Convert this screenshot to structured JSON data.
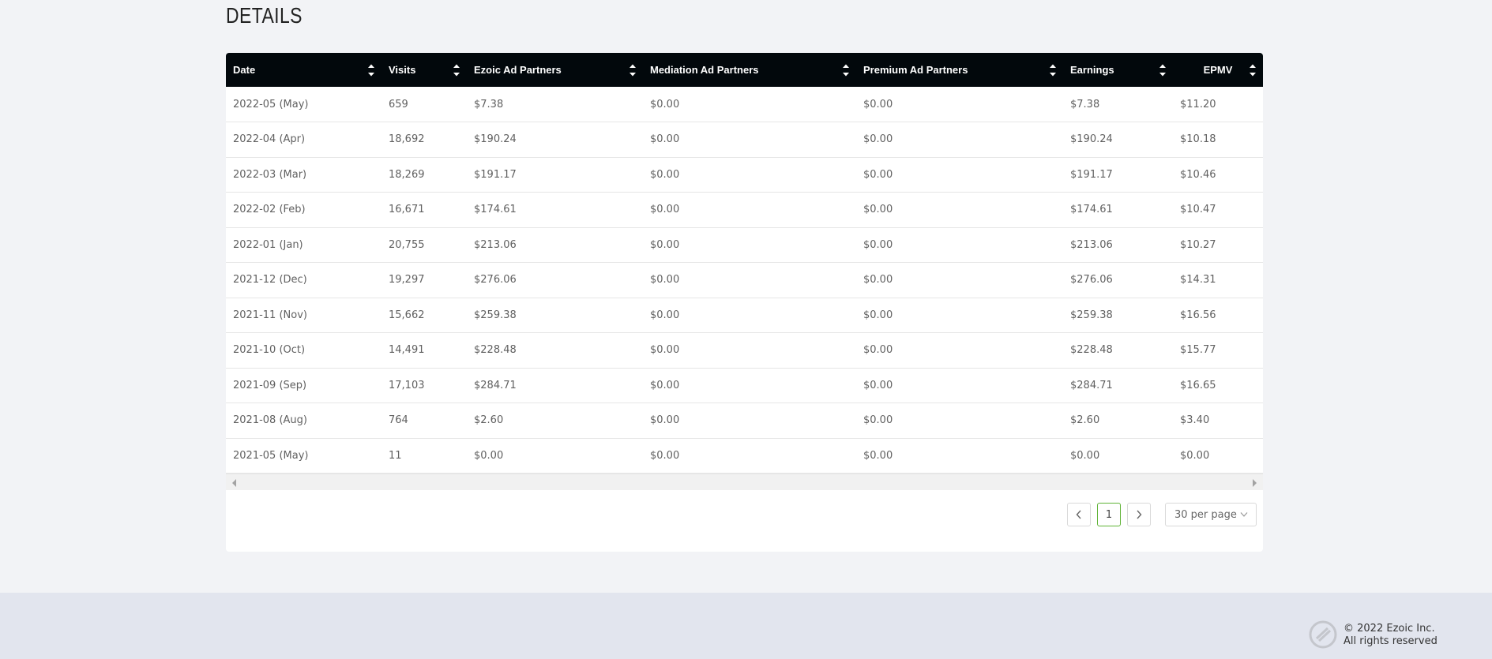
{
  "section": {
    "title": "DETAILS"
  },
  "table": {
    "columns": [
      "Date",
      "Visits",
      "Ezoic Ad Partners",
      "Mediation Ad Partners",
      "Premium Ad Partners",
      "Earnings",
      "EPMV"
    ],
    "rows": [
      [
        "2022-05 (May)",
        "659",
        "$7.38",
        "$0.00",
        "$0.00",
        "$7.38",
        "$11.20"
      ],
      [
        "2022-04 (Apr)",
        "18,692",
        "$190.24",
        "$0.00",
        "$0.00",
        "$190.24",
        "$10.18"
      ],
      [
        "2022-03 (Mar)",
        "18,269",
        "$191.17",
        "$0.00",
        "$0.00",
        "$191.17",
        "$10.46"
      ],
      [
        "2022-02 (Feb)",
        "16,671",
        "$174.61",
        "$0.00",
        "$0.00",
        "$174.61",
        "$10.47"
      ],
      [
        "2022-01 (Jan)",
        "20,755",
        "$213.06",
        "$0.00",
        "$0.00",
        "$213.06",
        "$10.27"
      ],
      [
        "2021-12 (Dec)",
        "19,297",
        "$276.06",
        "$0.00",
        "$0.00",
        "$276.06",
        "$14.31"
      ],
      [
        "2021-11 (Nov)",
        "15,662",
        "$259.38",
        "$0.00",
        "$0.00",
        "$259.38",
        "$16.56"
      ],
      [
        "2021-10 (Oct)",
        "14,491",
        "$228.48",
        "$0.00",
        "$0.00",
        "$228.48",
        "$15.77"
      ],
      [
        "2021-09 (Sep)",
        "17,103",
        "$284.71",
        "$0.00",
        "$0.00",
        "$284.71",
        "$16.65"
      ],
      [
        "2021-08 (Aug)",
        "764",
        "$2.60",
        "$0.00",
        "$0.00",
        "$2.60",
        "$3.40"
      ],
      [
        "2021-05 (May)",
        "11",
        "$0.00",
        "$0.00",
        "$0.00",
        "$0.00",
        "$0.00"
      ]
    ]
  },
  "pagination": {
    "current_page": "1",
    "prev_icon": "chevron-left-icon",
    "next_icon": "chevron-right-icon",
    "per_page": "30 per page",
    "active_color": "#5fb336"
  },
  "footer": {
    "copyright": "© 2022 Ezoic Inc.",
    "rights": "All rights reserved",
    "logo_icon": "ezoic-logo-icon"
  },
  "colors": {
    "header_bg": "#02080c",
    "page_bg": "#f2f3f6",
    "footer_bg": "#e2e5ee"
  }
}
